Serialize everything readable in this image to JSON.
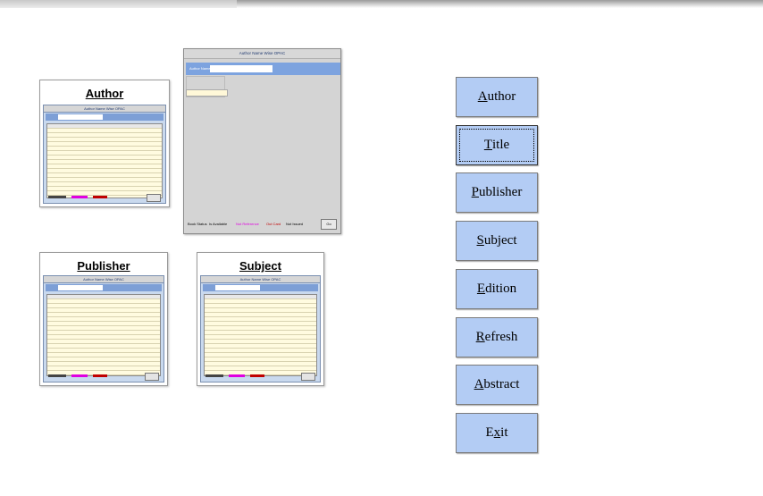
{
  "cards": {
    "author_title": "Author",
    "publisher_title": "Publisher",
    "subject_title": "Subject",
    "mini_window_title": "Author Name Wise OPAC",
    "mini_search_label": "Author Name"
  },
  "big_screenshot": {
    "window_title": "Author Name Wise OPAC",
    "search_label": "Author Name",
    "footer_label": "Book Status",
    "footer_items": [
      {
        "text": "Is Available",
        "color": "#000000"
      },
      {
        "text": "Not Reference",
        "color": "#e000e0"
      },
      {
        "text": "Out Card",
        "color": "#c00000"
      },
      {
        "text": "Not Issued",
        "color": "#000000"
      }
    ],
    "button_label": "Go"
  },
  "menu": [
    {
      "pre": "",
      "acc": "A",
      "post": "uthor"
    },
    {
      "pre": "",
      "acc": "T",
      "post": "itle"
    },
    {
      "pre": "",
      "acc": "P",
      "post": "ublisher"
    },
    {
      "pre": "",
      "acc": "S",
      "post": "ubject"
    },
    {
      "pre": "",
      "acc": "E",
      "post": "dition"
    },
    {
      "pre": "",
      "acc": "R",
      "post": "efresh"
    },
    {
      "pre": "",
      "acc": "A",
      "post": "bstract"
    },
    {
      "pre": "E",
      "acc": "x",
      "post": "it"
    }
  ],
  "selected_menu_index": 1,
  "colors": {
    "button_fill": "#b3ccf4",
    "search_bar": "#7da3df",
    "table_fill": "#fffbe0"
  }
}
